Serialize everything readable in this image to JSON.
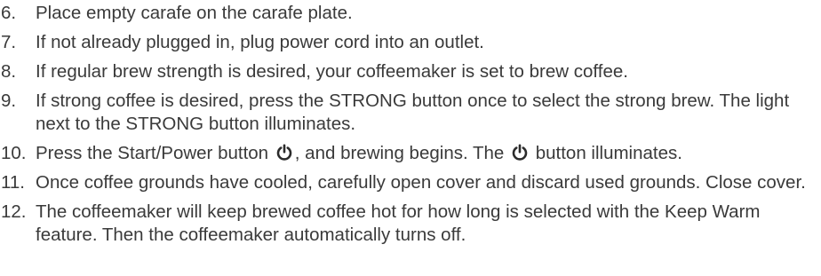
{
  "steps": [
    {
      "number": "6.",
      "text": "Place empty carafe on the carafe plate."
    },
    {
      "number": "7.",
      "text": "If not already plugged in, plug power cord into an outlet."
    },
    {
      "number": "8.",
      "text": "If regular brew strength is desired, your coffeemaker is set to brew coffee."
    },
    {
      "number": "9.",
      "text": "If strong coffee is desired, press the STRONG button once to select the strong brew. The light next to the STRONG button illuminates."
    },
    {
      "number": "10.",
      "text_a": "Press the Start/Power button",
      "text_b": ", and brewing begins. The",
      "text_c": "button illuminates.",
      "icon": "power-icon"
    },
    {
      "number": "11.",
      "text": "Once coffee grounds have cooled, carefully open cover and discard used grounds. Close cover."
    },
    {
      "number": "12.",
      "text": "The coffeemaker will keep brewed coffee hot for how long is selected with the Keep Warm feature. Then the coffeemaker automatically turns off."
    }
  ],
  "colors": {
    "text": "#3a3a3a",
    "icon": "#2b2b2b"
  }
}
